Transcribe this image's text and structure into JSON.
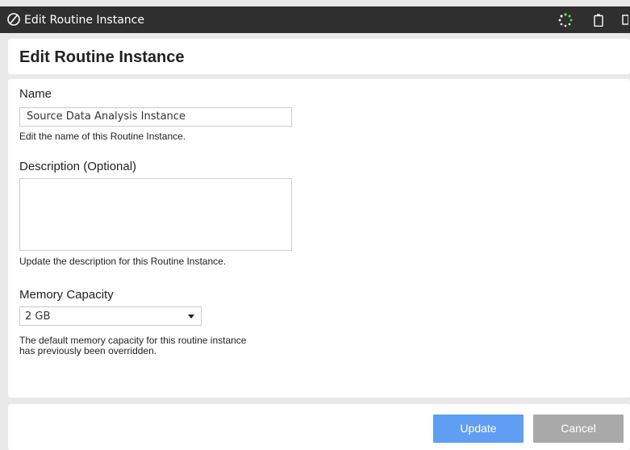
{
  "window": {
    "title": "Edit Routine Instance",
    "icons": [
      "app-logo-icon",
      "loading-spinner-icon",
      "battery-icon",
      "window-edge-icon"
    ]
  },
  "page": {
    "heading": "Edit Routine Instance"
  },
  "form": {
    "name": {
      "label": "Name",
      "value": "Source Data Analysis Instance",
      "help": "Edit the name of this Routine Instance."
    },
    "description": {
      "label": "Description (Optional)",
      "value": "",
      "help": "Update the description for this Routine Instance."
    },
    "memory": {
      "label": "Memory Capacity",
      "selected": "2 GB",
      "help_line1": "The default memory capacity for this routine instance",
      "help_line2": "has previously been overridden."
    }
  },
  "footer": {
    "update_label": "Update",
    "cancel_label": "Cancel"
  },
  "colors": {
    "titlebar": "#2f2f2f",
    "update_button": "#5f9ef2",
    "cancel_button": "#a9a9a9",
    "spinner": "#5fcf5f"
  }
}
